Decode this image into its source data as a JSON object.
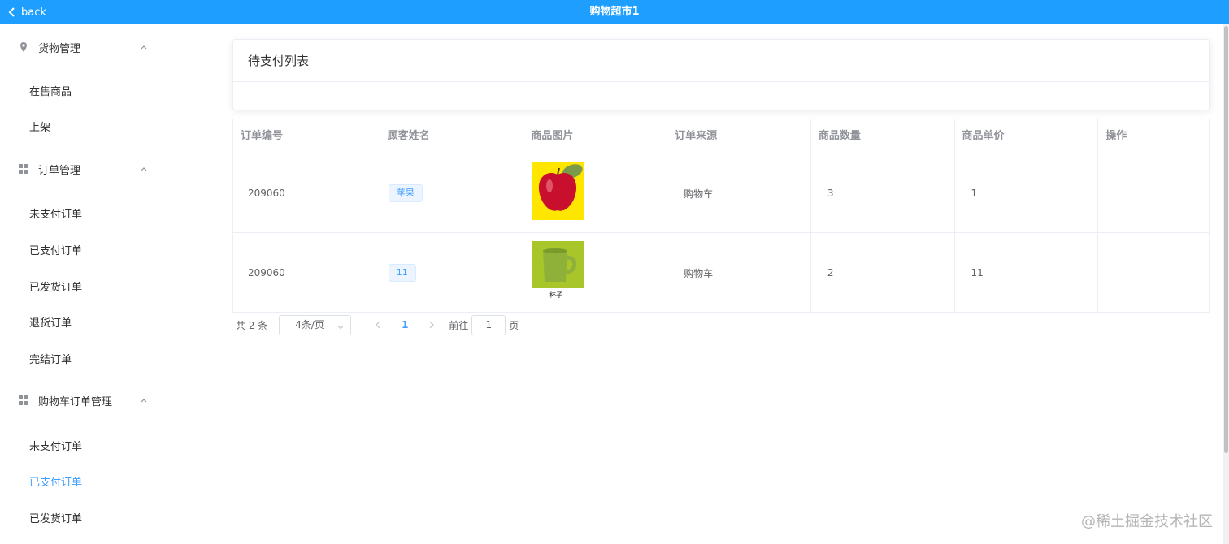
{
  "header": {
    "back_label": "back",
    "title": "购物超市1"
  },
  "sidebar": {
    "groups": [
      {
        "label": "货物管理",
        "icon": "location-icon",
        "items": [
          "在售商品",
          "上架"
        ]
      },
      {
        "label": "订单管理",
        "icon": "grid-icon",
        "items": [
          "未支付订单",
          "已支付订单",
          "已发货订单",
          "退货订单",
          "完结订单"
        ]
      },
      {
        "label": "购物车订单管理",
        "icon": "grid-icon",
        "items": [
          "未支付订单",
          "已支付订单",
          "已发货订单"
        ]
      }
    ],
    "active_item": "购物车订单管理/已支付订单"
  },
  "card": {
    "title": "待支付列表"
  },
  "table": {
    "columns": [
      "订单编号",
      "顾客姓名",
      "商品图片",
      "订单来源",
      "商品数量",
      "商品单价",
      "操作"
    ],
    "rows": [
      {
        "order_id": "209060",
        "customer": "苹果",
        "image": "apple",
        "source": "购物车",
        "quantity": "3",
        "price": "1",
        "action": ""
      },
      {
        "order_id": "209060",
        "customer": "11",
        "image": "cup",
        "source": "购物车",
        "quantity": "2",
        "price": "11",
        "action": "",
        "image_caption": "杯子"
      }
    ]
  },
  "pagination": {
    "total": "共 2 条",
    "page_size": "4条/页",
    "current_page": "1",
    "goto_label": "前往",
    "goto_value": "1",
    "page_suffix": "页"
  },
  "watermark": "@稀土掘金技术社区",
  "colors": {
    "header_bg": "#1e9fff",
    "active": "#409eff"
  }
}
